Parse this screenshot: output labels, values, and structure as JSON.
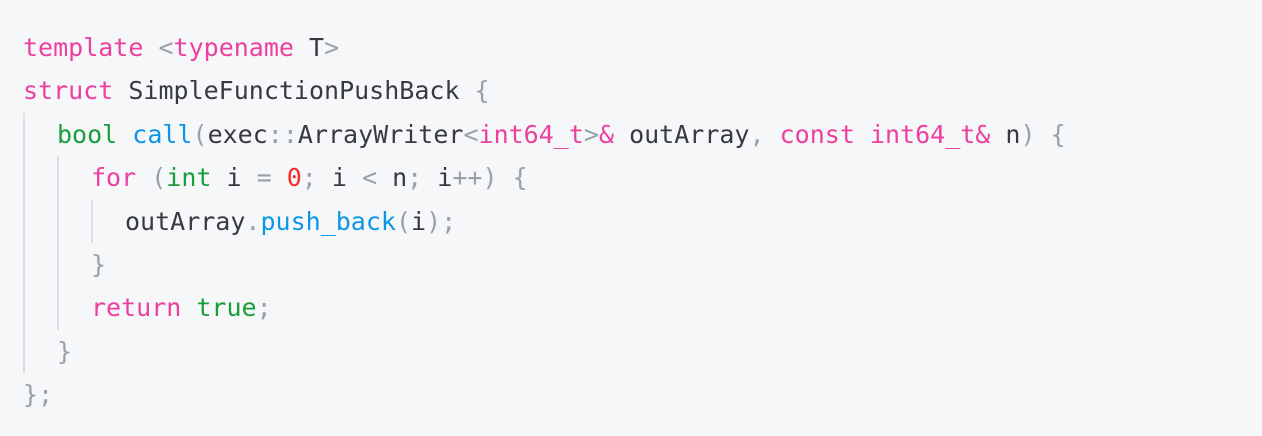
{
  "code": {
    "lines": [
      {
        "tokens": [
          {
            "t": "template",
            "k": "kw"
          },
          {
            "t": " ",
            "k": "id"
          },
          {
            "t": "<",
            "k": "punc"
          },
          {
            "t": "typename",
            "k": "kw"
          },
          {
            "t": " T",
            "k": "id"
          },
          {
            "t": ">",
            "k": "punc"
          }
        ]
      },
      {
        "tokens": [
          {
            "t": "struct",
            "k": "kw"
          },
          {
            "t": " SimpleFunctionPushBack ",
            "k": "id"
          },
          {
            "t": "{",
            "k": "punc"
          }
        ]
      },
      {
        "tokens": [
          {
            "t": "bool",
            "k": "type"
          },
          {
            "t": " ",
            "k": "id"
          },
          {
            "t": "call",
            "k": "fn"
          },
          {
            "t": "(",
            "k": "punc"
          },
          {
            "t": "exec",
            "k": "id"
          },
          {
            "t": "::",
            "k": "punc"
          },
          {
            "t": "ArrayWriter",
            "k": "id"
          },
          {
            "t": "<",
            "k": "punc"
          },
          {
            "t": "int64_t",
            "k": "kw"
          },
          {
            "t": ">",
            "k": "punc"
          },
          {
            "t": "&",
            "k": "kw"
          },
          {
            "t": " outArray",
            "k": "id"
          },
          {
            "t": ",",
            "k": "punc"
          },
          {
            "t": " ",
            "k": "id"
          },
          {
            "t": "const",
            "k": "kw"
          },
          {
            "t": " ",
            "k": "id"
          },
          {
            "t": "int64_t",
            "k": "kw"
          },
          {
            "t": "&",
            "k": "kw"
          },
          {
            "t": " n",
            "k": "id"
          },
          {
            "t": ")",
            "k": "punc"
          },
          {
            "t": " ",
            "k": "id"
          },
          {
            "t": "{",
            "k": "punc"
          }
        ]
      },
      {
        "tokens": [
          {
            "t": "for",
            "k": "kw"
          },
          {
            "t": " ",
            "k": "id"
          },
          {
            "t": "(",
            "k": "punc"
          },
          {
            "t": "int",
            "k": "type"
          },
          {
            "t": " i ",
            "k": "id"
          },
          {
            "t": "=",
            "k": "punc"
          },
          {
            "t": " ",
            "k": "id"
          },
          {
            "t": "0",
            "k": "num"
          },
          {
            "t": ";",
            "k": "punc"
          },
          {
            "t": " i ",
            "k": "id"
          },
          {
            "t": "<",
            "k": "punc"
          },
          {
            "t": " n",
            "k": "id"
          },
          {
            "t": ";",
            "k": "punc"
          },
          {
            "t": " i",
            "k": "id"
          },
          {
            "t": "++",
            "k": "punc"
          },
          {
            "t": ")",
            "k": "punc"
          },
          {
            "t": " ",
            "k": "id"
          },
          {
            "t": "{",
            "k": "punc"
          }
        ]
      },
      {
        "tokens": [
          {
            "t": "outArray",
            "k": "id"
          },
          {
            "t": ".",
            "k": "punc"
          },
          {
            "t": "push_back",
            "k": "fn"
          },
          {
            "t": "(",
            "k": "punc"
          },
          {
            "t": "i",
            "k": "id"
          },
          {
            "t": ");",
            "k": "punc"
          }
        ]
      },
      {
        "tokens": [
          {
            "t": "}",
            "k": "punc"
          }
        ]
      },
      {
        "tokens": [
          {
            "t": "return",
            "k": "kw"
          },
          {
            "t": " ",
            "k": "id"
          },
          {
            "t": "true",
            "k": "type"
          },
          {
            "t": ";",
            "k": "punc"
          }
        ]
      },
      {
        "tokens": [
          {
            "t": "}",
            "k": "punc"
          }
        ]
      },
      {
        "tokens": [
          {
            "t": "};",
            "k": "punc"
          }
        ]
      }
    ]
  },
  "colors": {
    "background": "#f6f7f8",
    "keyword": "#ec3fa0",
    "type": "#1a9d3c",
    "function": "#0d96e6",
    "number": "#f12d2d",
    "punctuation": "#9aa0ab",
    "identifier": "#383a42",
    "indent_guide": "#dcdee3"
  }
}
